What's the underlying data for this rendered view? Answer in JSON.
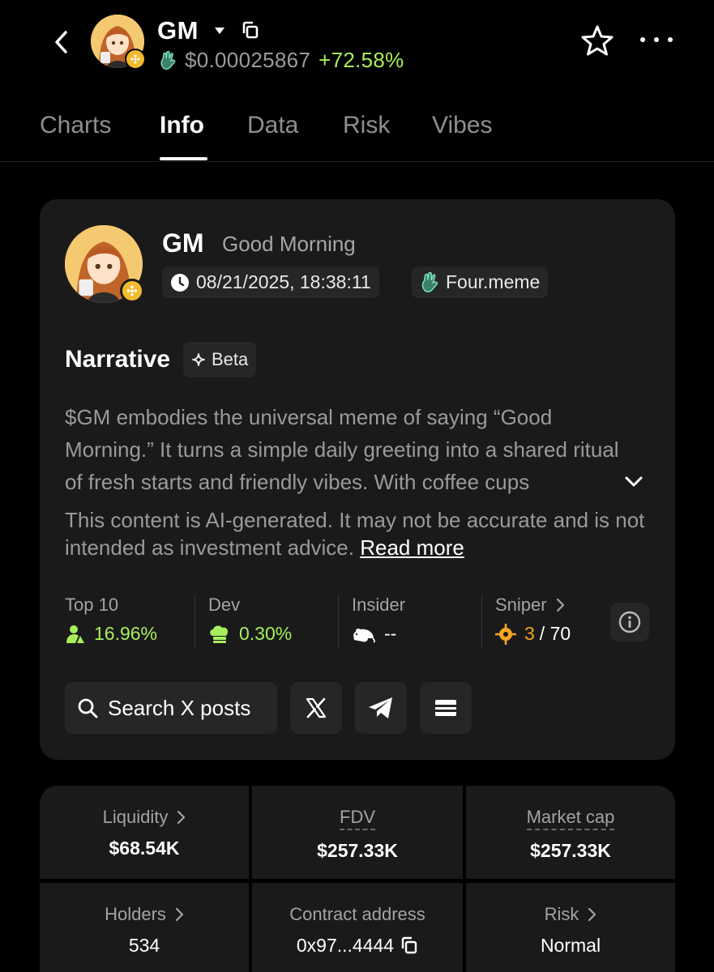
{
  "header": {
    "symbol": "GM",
    "price": "$0.00025867",
    "change": "+72.58%"
  },
  "tabs": [
    {
      "label": "Charts",
      "active": false
    },
    {
      "label": "Info",
      "active": true
    },
    {
      "label": "Data",
      "active": false
    },
    {
      "label": "Risk",
      "active": false
    },
    {
      "label": "Vibes",
      "active": false
    }
  ],
  "card": {
    "symbol": "GM",
    "name": "Good Morning",
    "created": "08/21/2025, 18:38:11",
    "launchpad": "Four.meme",
    "narrative_title": "Narrative",
    "beta_label": "Beta",
    "narrative_text": "$GM embodies the universal meme of saying “Good Morning.” It turns a simple daily greeting into a shared ritual of fresh starts and friendly vibes. With coffee cups",
    "disclaimer": "This content is AI-generated. It may not be accurate and is not intended as investment advice.",
    "read_more": "Read more",
    "stats": {
      "top10": {
        "label": "Top 10",
        "value": "16.96%"
      },
      "dev": {
        "label": "Dev",
        "value": "0.30%"
      },
      "insider": {
        "label": "Insider",
        "value": "--"
      },
      "sniper": {
        "label": "Sniper",
        "value": "3",
        "total": "/ 70"
      }
    },
    "search_x": "Search X posts"
  },
  "metrics": {
    "liquidity": {
      "label": "Liquidity",
      "value": "$68.54K"
    },
    "fdv": {
      "label": "FDV",
      "value": "$257.33K"
    },
    "market_cap": {
      "label": "Market cap",
      "value": "$257.33K"
    },
    "holders": {
      "label": "Holders",
      "value": "534"
    },
    "contract": {
      "label": "Contract address",
      "value": "0x97...4444"
    },
    "risk": {
      "label": "Risk",
      "value": "Normal"
    }
  },
  "colors": {
    "positive": "#a7ee5c",
    "sniper": "#f5a623",
    "chain_badge": "#f3ba2f",
    "card_bg": "#1a1a1a"
  },
  "icons": [
    "back-chevron-icon",
    "bnb-chain-icon",
    "dropdown-caret-icon",
    "copy-icon",
    "four-meme-hand-icon",
    "star-icon",
    "more-dots-icon",
    "clock-icon",
    "sparkle-icon",
    "chevron-down-icon",
    "top10-person-icon",
    "dev-chef-hat-icon",
    "insider-rat-icon",
    "sniper-crosshair-icon",
    "info-circle-icon",
    "search-icon",
    "x-logo-icon",
    "telegram-icon",
    "website-icon"
  ]
}
